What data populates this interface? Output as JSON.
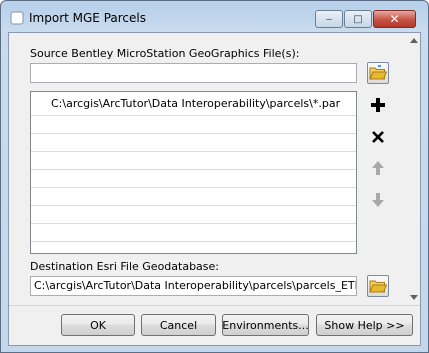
{
  "window": {
    "title": "Import MGE Parcels",
    "minimize_symbol": "‒",
    "maximize_symbol": "□",
    "close_symbol": "✕"
  },
  "source": {
    "label": "Source Bentley MicroStation GeoGraphics File(s):",
    "input_value": "",
    "list_items": [
      "C:\\arcgis\\ArcTutor\\Data Interoperability\\parcels\\*.par"
    ]
  },
  "destination": {
    "label": "Destination Esri File Geodatabase:",
    "input_value": "C:\\arcgis\\ArcTutor\\Data Interoperability\\parcels\\parcels_ETL.gdb"
  },
  "buttons": {
    "ok": "OK",
    "cancel": "Cancel",
    "environments": "Environments...",
    "show_help": "Show Help >>"
  },
  "icons": {
    "open_folder": "open-folder-icon",
    "add": "plus-icon",
    "remove": "x-icon",
    "move_up": "up-arrow-icon",
    "move_down": "down-arrow-icon"
  },
  "colors": {
    "title_bar": "#b9d1ea",
    "close_button": "#c65345",
    "folder_yellow": "#e8b92e"
  }
}
